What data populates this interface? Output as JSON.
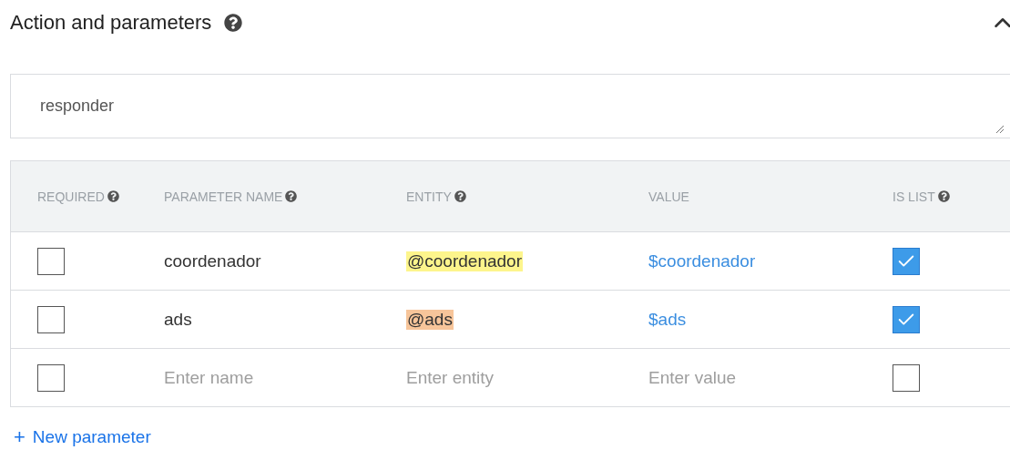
{
  "section": {
    "title": "Action and parameters",
    "expanded": true
  },
  "action": {
    "value": "responder"
  },
  "table": {
    "columns": [
      {
        "label": "REQUIRED",
        "help": true
      },
      {
        "label": "PARAMETER NAME",
        "help": true
      },
      {
        "label": "ENTITY",
        "help": true
      },
      {
        "label": "VALUE",
        "help": false
      },
      {
        "label": "IS LIST",
        "help": true
      }
    ],
    "rows": [
      {
        "kind": "param",
        "required": false,
        "name": "coordenador",
        "entity": "@coordenador",
        "color": "#fdf58c",
        "value": "$coordenador",
        "is_list": true
      },
      {
        "kind": "param",
        "required": false,
        "name": "ads",
        "entity": "@ads",
        "color": "#f7c59a",
        "value": "$ads",
        "is_list": true
      },
      {
        "kind": "new",
        "required": false,
        "name_placeholder": "Enter name",
        "entity_placeholder": "Enter entity",
        "value_placeholder": "Enter value",
        "is_list": false
      }
    ]
  },
  "new_parameter": {
    "icon": "+",
    "label": "New parameter"
  }
}
